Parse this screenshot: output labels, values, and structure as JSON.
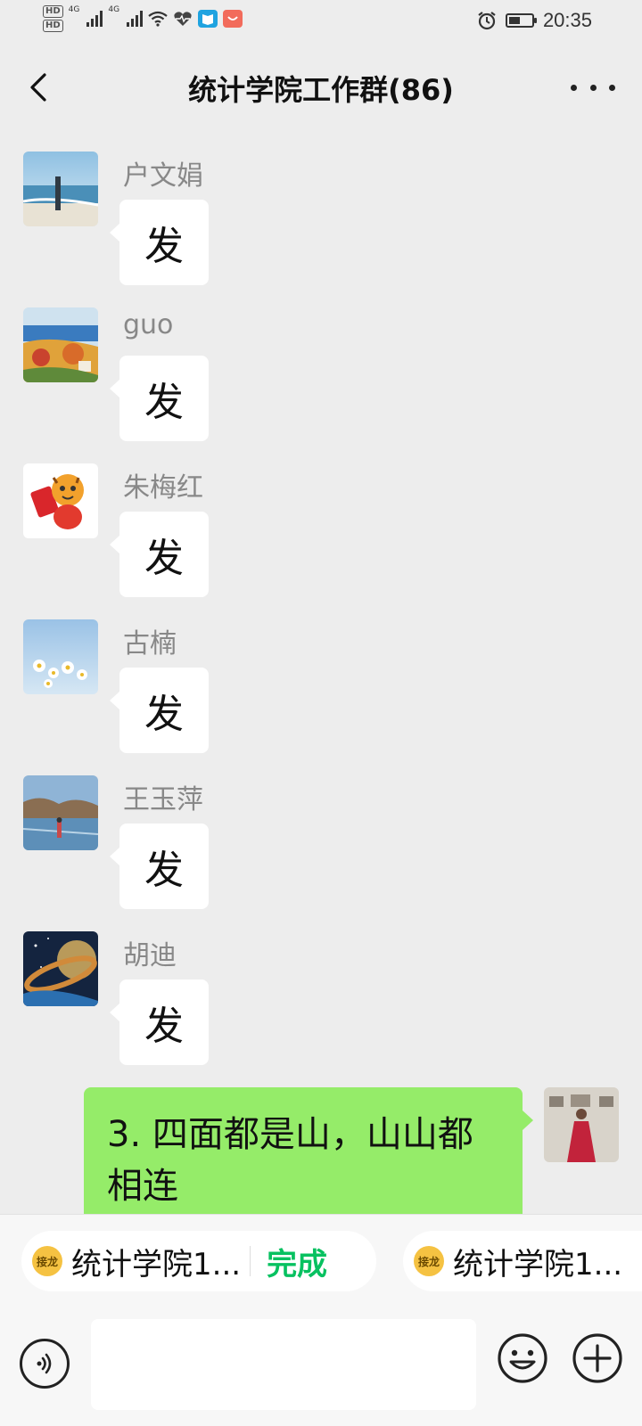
{
  "status_bar": {
    "hd1": "HD",
    "hd2": "HD",
    "sig1": "4G",
    "sig2": "4G",
    "time": "20:35",
    "battery_level": 0.5
  },
  "header": {
    "title": "统计学院工作群(86)",
    "back_icon": "chevron-left-icon",
    "more_icon": "more-dots-icon"
  },
  "messages": [
    {
      "sender": "户文娟",
      "text": "发"
    },
    {
      "sender": "guo",
      "text": "发"
    },
    {
      "sender": "朱梅红",
      "text": "发"
    },
    {
      "sender": "古楠",
      "text": "发"
    },
    {
      "sender": "王玉萍",
      "text": "发"
    },
    {
      "sender": "胡迪",
      "text": "发"
    }
  ],
  "own_message": {
    "text": "3. 四面都是山，山山都相连"
  },
  "jielong": {
    "icon_text": "接龙",
    "item1": "统计学院1...",
    "done": "完成",
    "item2": "统计学院1..."
  },
  "input": {
    "voice_icon": "voice-icon",
    "emoji_icon": "emoji-icon",
    "plus_icon": "plus-circle-icon",
    "placeholder": ""
  },
  "colors": {
    "background": "#ededed",
    "own_bubble": "#95ec69",
    "accent": "#07c160",
    "bubble": "#ffffff"
  }
}
